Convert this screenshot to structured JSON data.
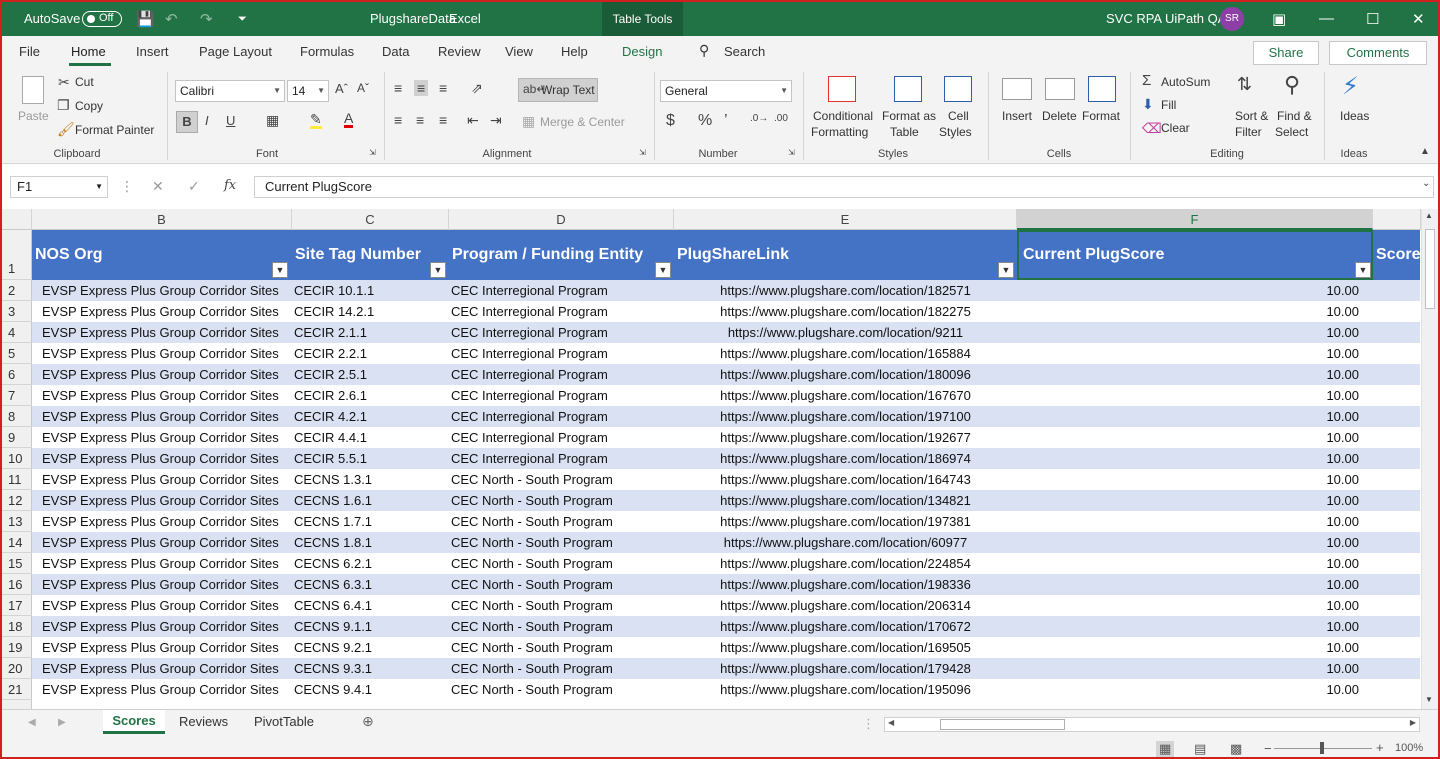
{
  "titlebar": {
    "autosave_label": "AutoSave",
    "autosave_state": "Off",
    "filename": "PlugshareData",
    "app": "Excel",
    "table_tools": "Table Tools",
    "user_name": "SVC RPA UiPath QA",
    "user_initials": "SR"
  },
  "tabs": [
    "File",
    "Home",
    "Insert",
    "Page Layout",
    "Formulas",
    "Data",
    "Review",
    "View",
    "Help",
    "Design"
  ],
  "search_label": "Search",
  "share_label": "Share",
  "comments_label": "Comments",
  "ribbon": {
    "paste": "Paste",
    "cut": "Cut",
    "copy": "Copy",
    "format_painter": "Format Painter",
    "clipboard": "Clipboard",
    "font_name": "Calibri",
    "font_size": "14",
    "font": "Font",
    "wrap_text": "Wrap Text",
    "merge_center": "Merge & Center",
    "alignment": "Alignment",
    "number_format": "General",
    "number": "Number",
    "conditional_formatting": "Conditional",
    "conditional_formatting2": "Formatting",
    "format_as_table": "Format as",
    "format_as_table2": "Table",
    "cell_styles": "Cell",
    "cell_styles2": "Styles",
    "styles": "Styles",
    "insert": "Insert",
    "delete": "Delete",
    "format": "Format",
    "cells": "Cells",
    "autosum": "AutoSum",
    "fill": "Fill",
    "clear": "Clear",
    "sort_filter": "Sort &",
    "sort_filter2": "Filter",
    "find_select": "Find &",
    "find_select2": "Select",
    "editing": "Editing",
    "ideas": "Ideas",
    "ideas_group": "Ideas"
  },
  "formula_bar": {
    "name_box": "F1",
    "fx": "fx",
    "content": "Current PlugScore"
  },
  "columns": [
    "B",
    "C",
    "D",
    "E",
    "F"
  ],
  "table_headers": {
    "b": "NOS Org",
    "c": "Site Tag Number",
    "d": "Program / Funding Entity",
    "e": "PlugShareLink",
    "f": "Current PlugScore",
    "g": "Score"
  },
  "rows": [
    {
      "n": "1"
    },
    {
      "n": "2",
      "b": "EVSP Express Plus Group Corridor Sites",
      "c": "CECIR 10.1.1",
      "d": "CEC Interregional Program",
      "e": "https://www.plugshare.com/location/182571",
      "f": "10.00"
    },
    {
      "n": "3",
      "b": "EVSP Express Plus Group Corridor Sites",
      "c": "CECIR 14.2.1",
      "d": "CEC Interregional Program",
      "e": "https://www.plugshare.com/location/182275",
      "f": "10.00"
    },
    {
      "n": "4",
      "b": "EVSP Express Plus Group Corridor Sites",
      "c": "CECIR 2.1.1",
      "d": "CEC Interregional Program",
      "e": "https://www.plugshare.com/location/9211",
      "f": "10.00"
    },
    {
      "n": "5",
      "b": "EVSP Express Plus Group Corridor Sites",
      "c": "CECIR 2.2.1",
      "d": "CEC Interregional Program",
      "e": "https://www.plugshare.com/location/165884",
      "f": "10.00"
    },
    {
      "n": "6",
      "b": "EVSP Express Plus Group Corridor Sites",
      "c": "CECIR 2.5.1",
      "d": "CEC Interregional Program",
      "e": "https://www.plugshare.com/location/180096",
      "f": "10.00"
    },
    {
      "n": "7",
      "b": "EVSP Express Plus Group Corridor Sites",
      "c": "CECIR 2.6.1",
      "d": "CEC Interregional Program",
      "e": "https://www.plugshare.com/location/167670",
      "f": "10.00"
    },
    {
      "n": "8",
      "b": "EVSP Express Plus Group Corridor Sites",
      "c": "CECIR 4.2.1",
      "d": "CEC Interregional Program",
      "e": "https://www.plugshare.com/location/197100",
      "f": "10.00"
    },
    {
      "n": "9",
      "b": "EVSP Express Plus Group Corridor Sites",
      "c": "CECIR 4.4.1",
      "d": "CEC Interregional Program",
      "e": "https://www.plugshare.com/location/192677",
      "f": "10.00"
    },
    {
      "n": "10",
      "b": "EVSP Express Plus Group Corridor Sites",
      "c": "CECIR 5.5.1",
      "d": "CEC Interregional Program",
      "e": "https://www.plugshare.com/location/186974",
      "f": "10.00"
    },
    {
      "n": "11",
      "b": "EVSP Express Plus Group Corridor Sites",
      "c": "CECNS 1.3.1",
      "d": "CEC North - South Program",
      "e": "https://www.plugshare.com/location/164743",
      "f": "10.00"
    },
    {
      "n": "12",
      "b": "EVSP Express Plus Group Corridor Sites",
      "c": "CECNS 1.6.1",
      "d": "CEC North - South Program",
      "e": "https://www.plugshare.com/location/134821",
      "f": "10.00"
    },
    {
      "n": "13",
      "b": "EVSP Express Plus Group Corridor Sites",
      "c": "CECNS 1.7.1",
      "d": "CEC North - South Program",
      "e": "https://www.plugshare.com/location/197381",
      "f": "10.00"
    },
    {
      "n": "14",
      "b": "EVSP Express Plus Group Corridor Sites",
      "c": "CECNS 1.8.1",
      "d": "CEC North - South Program",
      "e": "https://www.plugshare.com/location/60977",
      "f": "10.00"
    },
    {
      "n": "15",
      "b": "EVSP Express Plus Group Corridor Sites",
      "c": "CECNS 6.2.1",
      "d": "CEC North - South Program",
      "e": "https://www.plugshare.com/location/224854",
      "f": "10.00"
    },
    {
      "n": "16",
      "b": "EVSP Express Plus Group Corridor Sites",
      "c": "CECNS 6.3.1",
      "d": "CEC North - South Program",
      "e": "https://www.plugshare.com/location/198336",
      "f": "10.00"
    },
    {
      "n": "17",
      "b": "EVSP Express Plus Group Corridor Sites",
      "c": "CECNS 6.4.1",
      "d": "CEC North - South Program",
      "e": "https://www.plugshare.com/location/206314",
      "f": "10.00"
    },
    {
      "n": "18",
      "b": "EVSP Express Plus Group Corridor Sites",
      "c": "CECNS 9.1.1",
      "d": "CEC North - South Program",
      "e": "https://www.plugshare.com/location/170672",
      "f": "10.00"
    },
    {
      "n": "19",
      "b": "EVSP Express Plus Group Corridor Sites",
      "c": "CECNS 9.2.1",
      "d": "CEC North - South Program",
      "e": "https://www.plugshare.com/location/169505",
      "f": "10.00"
    },
    {
      "n": "20",
      "b": "EVSP Express Plus Group Corridor Sites",
      "c": "CECNS 9.3.1",
      "d": "CEC North - South Program",
      "e": "https://www.plugshare.com/location/179428",
      "f": "10.00"
    },
    {
      "n": "21",
      "b": "EVSP Express Plus Group Corridor Sites",
      "c": "CECNS 9.4.1",
      "d": "CEC North - South Program",
      "e": "https://www.plugshare.com/location/195096",
      "f": "10.00"
    }
  ],
  "sheets": [
    "Scores",
    "Reviews",
    "PivotTable"
  ],
  "active_sheet": "Scores",
  "zoom": "100%",
  "colors": {
    "excel_green": "#217346",
    "table_header": "#4472c4",
    "band": "#d9e1f2",
    "frame": "#d21f1f"
  }
}
